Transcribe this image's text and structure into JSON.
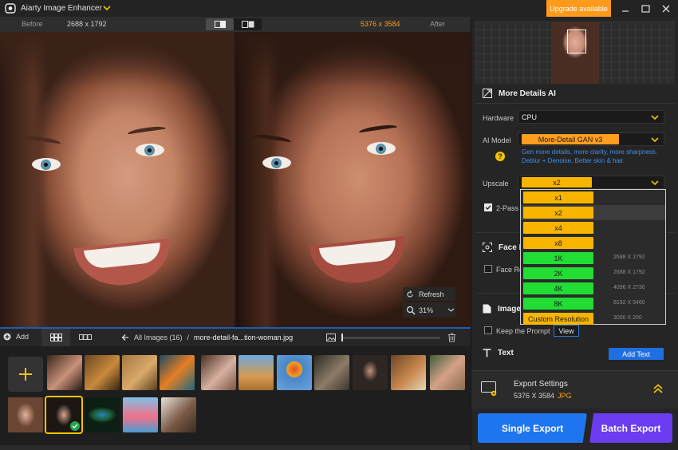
{
  "app": {
    "title": "Aiarty Image Enhancer",
    "upgrade_label": "Upgrade available"
  },
  "compare": {
    "before_label": "Before",
    "before_dims": "2688 x 1792",
    "after_dims": "5376 x 3584",
    "after_label": "After"
  },
  "viewer": {
    "refresh_label": "Refresh",
    "zoom": "31%"
  },
  "toolbar": {
    "add_label": "Add",
    "all_images_label": "All Images (16)",
    "separator": "/",
    "current_file": "more-detail-fa...tion-woman.jpg"
  },
  "panel": {
    "section_title": "More Details AI",
    "hardware_label": "Hardware",
    "hardware_value": "CPU",
    "ai_model_label": "AI Model",
    "ai_model_value": "More-Detail GAN  v3",
    "ai_model_help": "?",
    "ai_model_desc": "Gen more details, more clarity, more sharpness. Deblur + Denoise. Better skin & hair.",
    "upscale_label": "Upscale",
    "upscale_value": "x2",
    "two_pass_label": "2-Pass",
    "face_section_partial": "Face R",
    "face_checkbox_partial": "Face Re",
    "image_section_partial": "Image",
    "keep_prompt_label": "Keep the Prompt",
    "view_label": "View",
    "text_section": "Text",
    "add_text_label": "Add Text"
  },
  "upscale_options": [
    {
      "label": "x1",
      "res": "",
      "kind": "gold"
    },
    {
      "label": "x2",
      "res": "",
      "kind": "gold"
    },
    {
      "label": "x4",
      "res": "",
      "kind": "gold"
    },
    {
      "label": "x8",
      "res": "",
      "kind": "gold"
    },
    {
      "label": "1K",
      "res": "2688 X 1792",
      "kind": "green"
    },
    {
      "label": "2K",
      "res": "2688 X 1792",
      "kind": "green"
    },
    {
      "label": "4K",
      "res": "4096 X 2730",
      "kind": "green"
    },
    {
      "label": "8K",
      "res": "8192 X 5460",
      "kind": "green"
    },
    {
      "label": "Custom Resolution",
      "res": "3000 X 200",
      "kind": "gold"
    }
  ],
  "upscale_highlighted": 1,
  "export": {
    "title": "Export Settings",
    "dims": "5376 X 3584",
    "format": "JPG",
    "single_label": "Single Export",
    "batch_label": "Batch Export"
  },
  "colors": {
    "accent_orange": "#ff9e1f",
    "accent_blue": "#1f75f0",
    "accent_purple": "#6b3cf0",
    "option_gold": "#f7b500",
    "option_green": "#22dd33",
    "selected_outline": "#f5c400"
  },
  "thumbnails": {
    "row1": [
      "portrait-glasses",
      "lion-cub-family",
      "lioness",
      "coral-reef",
      "woman-curly-hair",
      "lion-cub-sky",
      "hot-air-balloon",
      "owl",
      "man-portrait",
      "squirrels",
      "group-selfie"
    ],
    "row2": [
      "smiling-woman",
      "woman-dark-hair",
      "peacock-feather",
      "flamingo",
      "couple-dancing"
    ],
    "selected": "woman-dark-hair"
  }
}
